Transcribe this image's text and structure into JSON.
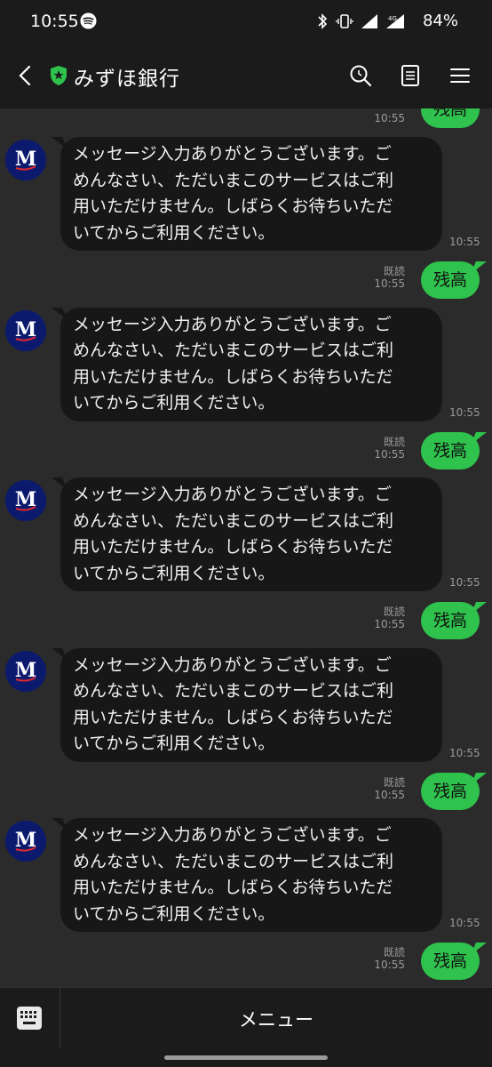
{
  "status_bar": {
    "time": "10:55",
    "battery": "84%",
    "icons": [
      "spotify-icon",
      "bluetooth-icon",
      "vibrate-icon",
      "wifi-icon",
      "signal-4g-icon"
    ]
  },
  "header": {
    "title": "みずほ銀行",
    "verified_color": "#2fc24d",
    "icons": [
      "back-arrow-icon",
      "search-icon",
      "notes-icon",
      "menu-icon"
    ]
  },
  "conversation": {
    "first_partial": {
      "text": "残高",
      "time": "10:55"
    },
    "exchanges": [
      {
        "incoming": [
          "メッセージ入力ありがとうございます。ご",
          "めんなさい、ただいまこのサービスはご利",
          "用いただけません。しばらくお待ちいただ",
          "いてからご利用ください。"
        ],
        "incoming_time": "10:55",
        "outgoing": "残高",
        "read": "既読",
        "outgoing_time": "10:55"
      },
      {
        "incoming": [
          "メッセージ入力ありがとうございます。ご",
          "めんなさい、ただいまこのサービスはご利",
          "用いただけません。しばらくお待ちいただ",
          "いてからご利用ください。"
        ],
        "incoming_time": "10:55",
        "outgoing": "残高",
        "read": "既読",
        "outgoing_time": "10:55"
      },
      {
        "incoming": [
          "メッセージ入力ありがとうございます。ご",
          "めんなさい、ただいまこのサービスはご利",
          "用いただけません。しばらくお待ちいただ",
          "いてからご利用ください。"
        ],
        "incoming_time": "10:55",
        "outgoing": "残高",
        "read": "既読",
        "outgoing_time": "10:55"
      },
      {
        "incoming": [
          "メッセージ入力ありがとうございます。ご",
          "めんなさい、ただいまこのサービスはご利",
          "用いただけません。しばらくお待ちいただ",
          "いてからご利用ください。"
        ],
        "incoming_time": "10:55",
        "outgoing": "残高",
        "read": "既読",
        "outgoing_time": "10:55"
      },
      {
        "incoming": [
          "メッセージ入力ありがとうございます。ご",
          "めんなさい、ただいまこのサービスはご利",
          "用いただけません。しばらくお待ちいただ",
          "いてからご利用ください。"
        ],
        "incoming_time": "10:55",
        "outgoing": "残高",
        "read": "既読",
        "outgoing_time": "10:55"
      }
    ]
  },
  "bottom_bar": {
    "menu_label": "メニュー",
    "keyboard_icon": "keyboard-icon"
  },
  "colors": {
    "background": "#2b2b2b",
    "bar": "#1b1b1b",
    "outgoing_bubble": "#2fc24d",
    "incoming_bubble": "#171717",
    "avatar": "#0c1a6e"
  }
}
